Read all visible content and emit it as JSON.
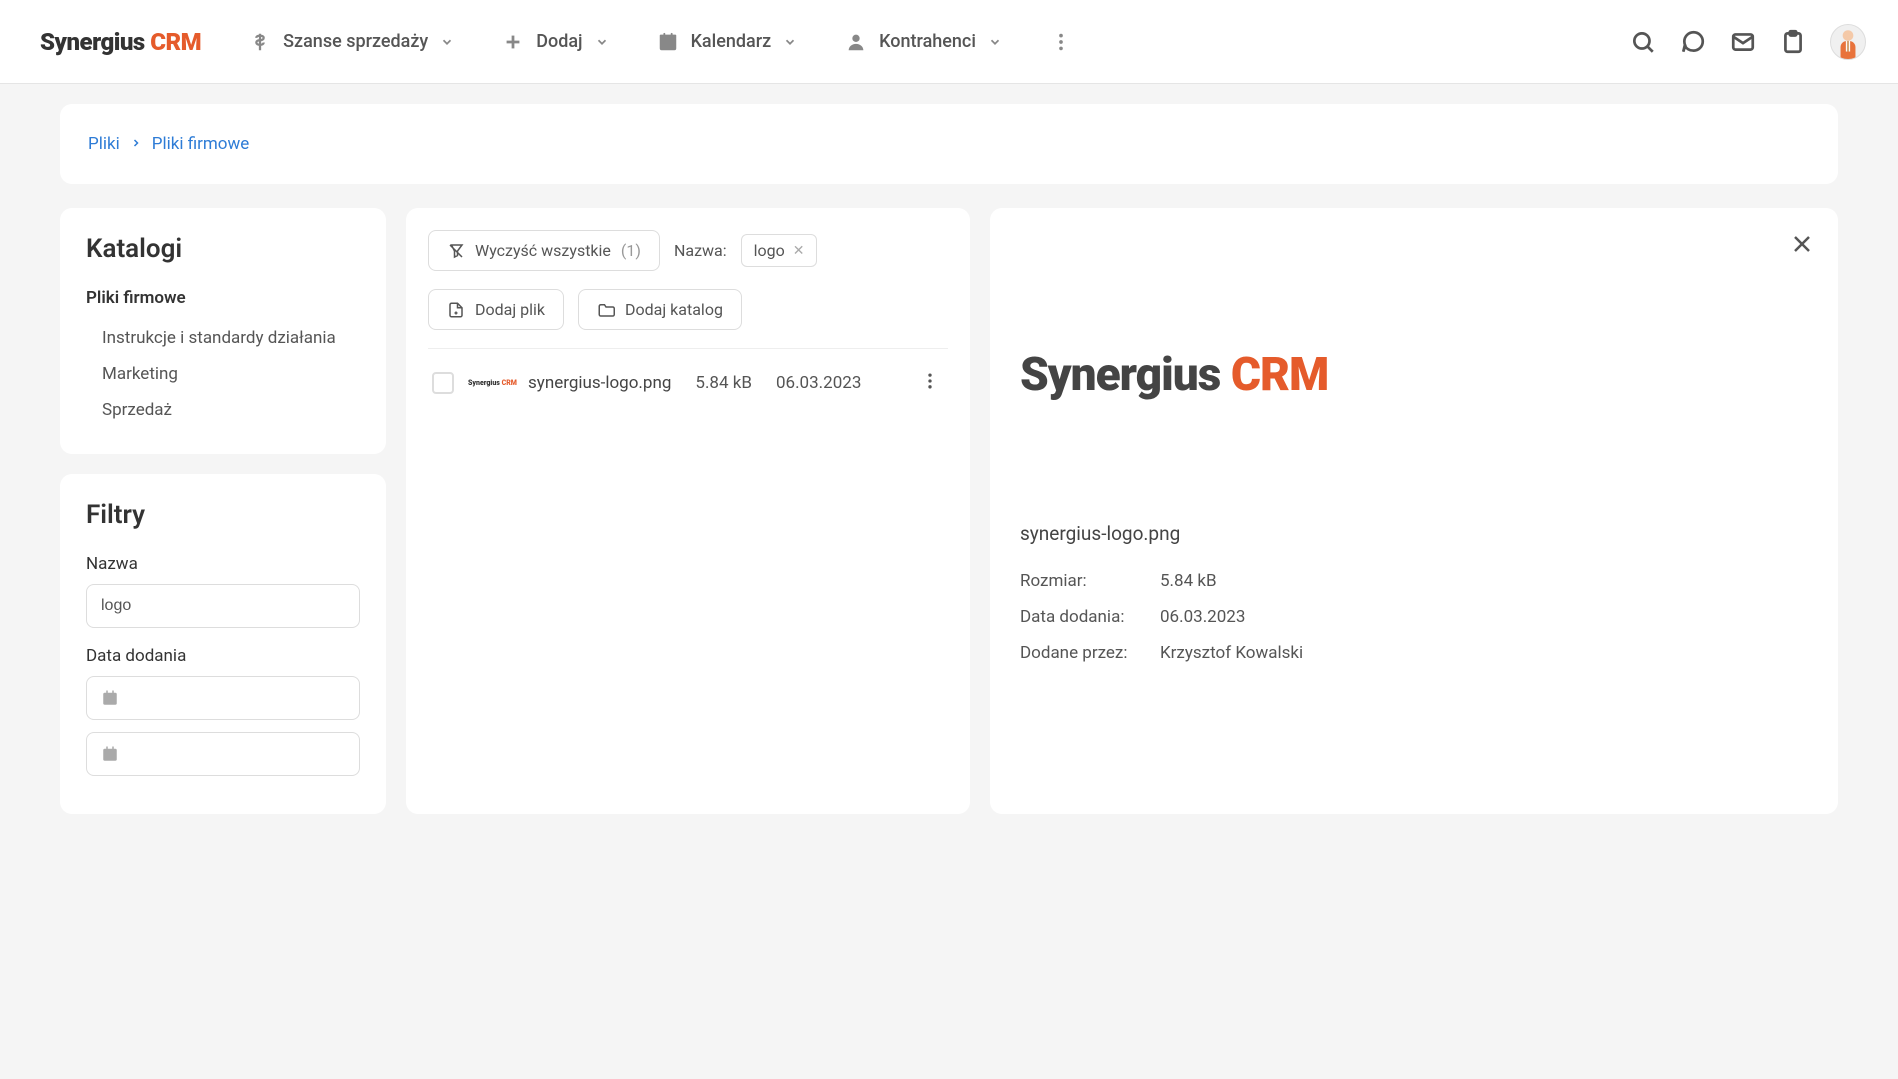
{
  "brand": {
    "name": "Synergius",
    "suffix": "CRM"
  },
  "nav": {
    "sales": "Szanse sprzedaży",
    "add": "Dodaj",
    "calendar": "Kalendarz",
    "contractors": "Kontrahenci"
  },
  "breadcrumb": {
    "root": "Pliki",
    "current": "Pliki firmowe"
  },
  "catalogs": {
    "heading": "Katalogi",
    "title": "Pliki firmowe",
    "items": [
      "Instrukcje i standardy działania",
      "Marketing",
      "Sprzedaż"
    ]
  },
  "filters": {
    "heading": "Filtry",
    "name_label": "Nazwa",
    "name_value": "logo",
    "date_label": "Data dodania"
  },
  "toolbar": {
    "clear_all": "Wyczyść wszystkie",
    "clear_count": "(1)",
    "name_label": "Nazwa:",
    "chip_value": "logo",
    "add_file": "Dodaj plik",
    "add_folder": "Dodaj katalog"
  },
  "file": {
    "name": "synergius-logo.png",
    "size": "5.84 kB",
    "date": "06.03.2023"
  },
  "detail": {
    "name": "synergius-logo.png",
    "size_label": "Rozmiar:",
    "size_value": "5.84 kB",
    "date_label": "Data dodania:",
    "date_value": "06.03.2023",
    "added_by_label": "Dodane przez:",
    "added_by_value": "Krzysztof Kowalski"
  }
}
